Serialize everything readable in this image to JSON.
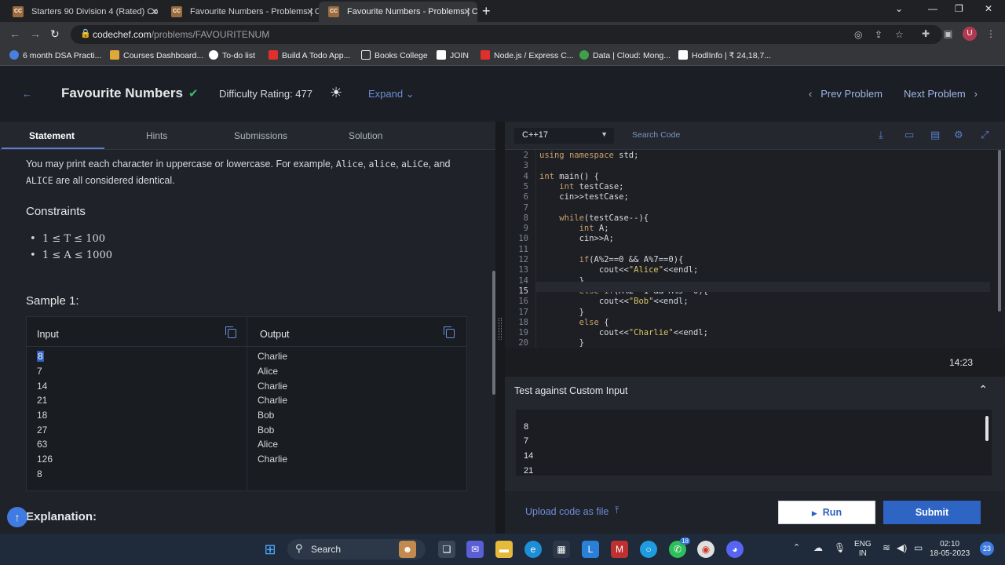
{
  "browser": {
    "tabs": [
      {
        "title": "Starters 90 Division 4 (Rated) Co",
        "favicon": "CC"
      },
      {
        "title": "Favourite Numbers - Problems | C",
        "favicon": "CC"
      },
      {
        "title": "Favourite Numbers - Problems | C",
        "favicon": "CC"
      }
    ],
    "url_host": "codechef.com",
    "url_path": "/problems/FAVOURITENUM",
    "profile_initial": "U",
    "bookmarks": [
      "6 month DSA Practi...",
      "Courses Dashboard...",
      "To-do list",
      "Build A Todo App...",
      "Books College",
      "JOIN",
      "Node.js / Express C...",
      "Data | Cloud: Mong...",
      "HodlInfo | ₹ 24,18,7..."
    ]
  },
  "header": {
    "title": "Favourite Numbers",
    "difficulty": "Difficulty Rating: 477",
    "expand": "Expand",
    "prev": "Prev Problem",
    "next": "Next Problem"
  },
  "panel_tabs": [
    "Statement",
    "Hints",
    "Submissions",
    "Solution"
  ],
  "statement": {
    "para_prefix": "You may print each character in uppercase or lowercase. For example,",
    "para_examples": [
      "Alice",
      "alice",
      "aLiCe",
      "ALICE"
    ],
    "para_and": "and",
    "para_suffix": "are all considered identical.",
    "constraints_title": "Constraints",
    "constraints": [
      "1 ≤ T ≤ 100",
      "1 ≤ A ≤ 1000"
    ],
    "sample_title": "Sample 1:",
    "input_label": "Input",
    "output_label": "Output",
    "inputs": [
      "8",
      "7",
      "14",
      "21",
      "18",
      "27",
      "63",
      "126",
      "8"
    ],
    "outputs": [
      "Charlie",
      "Alice",
      "Charlie",
      "Charlie",
      "Bob",
      "Bob",
      "Alice",
      "Charlie"
    ],
    "explanation_title": "Explanation:"
  },
  "editor": {
    "language": "C++17",
    "search_placeholder": "Search Code",
    "lines": [
      {
        "n": "2",
        "code": "using namespace std;"
      },
      {
        "n": "3",
        "code": ""
      },
      {
        "n": "4",
        "code": "int main() {"
      },
      {
        "n": "5",
        "code": "    int testCase;"
      },
      {
        "n": "6",
        "code": "    cin>>testCase;"
      },
      {
        "n": "7",
        "code": ""
      },
      {
        "n": "8",
        "code": "    while(testCase--){"
      },
      {
        "n": "9",
        "code": "        int A;"
      },
      {
        "n": "10",
        "code": "        cin>>A;"
      },
      {
        "n": "11",
        "code": ""
      },
      {
        "n": "12",
        "code": "        if(A%2==0 && A%7==0){"
      },
      {
        "n": "13",
        "code": "            cout<<\"Alice\"<<endl;"
      },
      {
        "n": "14",
        "code": "        }"
      },
      {
        "n": "15",
        "code": "        else if(A%2==1 && A%9==0){"
      },
      {
        "n": "16",
        "code": "            cout<<\"Bob\"<<endl;"
      },
      {
        "n": "17",
        "code": "        }"
      },
      {
        "n": "18",
        "code": "        else {"
      },
      {
        "n": "19",
        "code": "            cout<<\"Charlie\"<<endl;"
      },
      {
        "n": "20",
        "code": "        }"
      }
    ],
    "timer": "14:23"
  },
  "custom_input": {
    "title": "Test against Custom Input",
    "values": [
      "8",
      "7",
      "14",
      "21"
    ]
  },
  "actions": {
    "upload": "Upload code as file",
    "run": "Run",
    "submit": "Submit"
  },
  "taskbar": {
    "search": "Search",
    "lang_top": "ENG",
    "lang_bottom": "IN",
    "time": "02:10",
    "date": "18-05-2023",
    "notif": "23",
    "whatsapp_badge": "18"
  }
}
